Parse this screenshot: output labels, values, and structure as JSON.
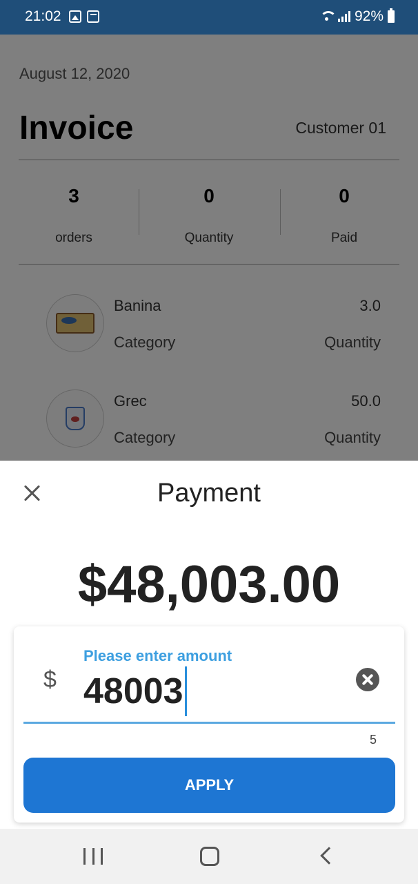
{
  "status_bar": {
    "time": "21:02",
    "battery": "92%"
  },
  "invoice": {
    "date": "August 12, 2020",
    "title": "Invoice",
    "customer": "Customer 01",
    "stats": [
      {
        "value": "3",
        "label": "orders"
      },
      {
        "value": "0",
        "label": "Quantity"
      },
      {
        "value": "0",
        "label": "Paid"
      }
    ],
    "items": [
      {
        "name": "Banina",
        "value": "3.0",
        "category_label": "Category",
        "quantity_label": "Quantity"
      },
      {
        "name": "Grec",
        "value": "50.0",
        "category_label": "Category",
        "quantity_label": "Quantity"
      }
    ]
  },
  "payment": {
    "title": "Payment",
    "amount": "$48,003.00",
    "currency_symbol": "$",
    "field_label": "Please enter amount",
    "field_value": "48003",
    "char_counter": "5",
    "apply_label": "APPLY"
  },
  "colors": {
    "status_bar": "#1f4e79",
    "accent": "#1e76d3",
    "label_blue": "#3d9fe0"
  }
}
